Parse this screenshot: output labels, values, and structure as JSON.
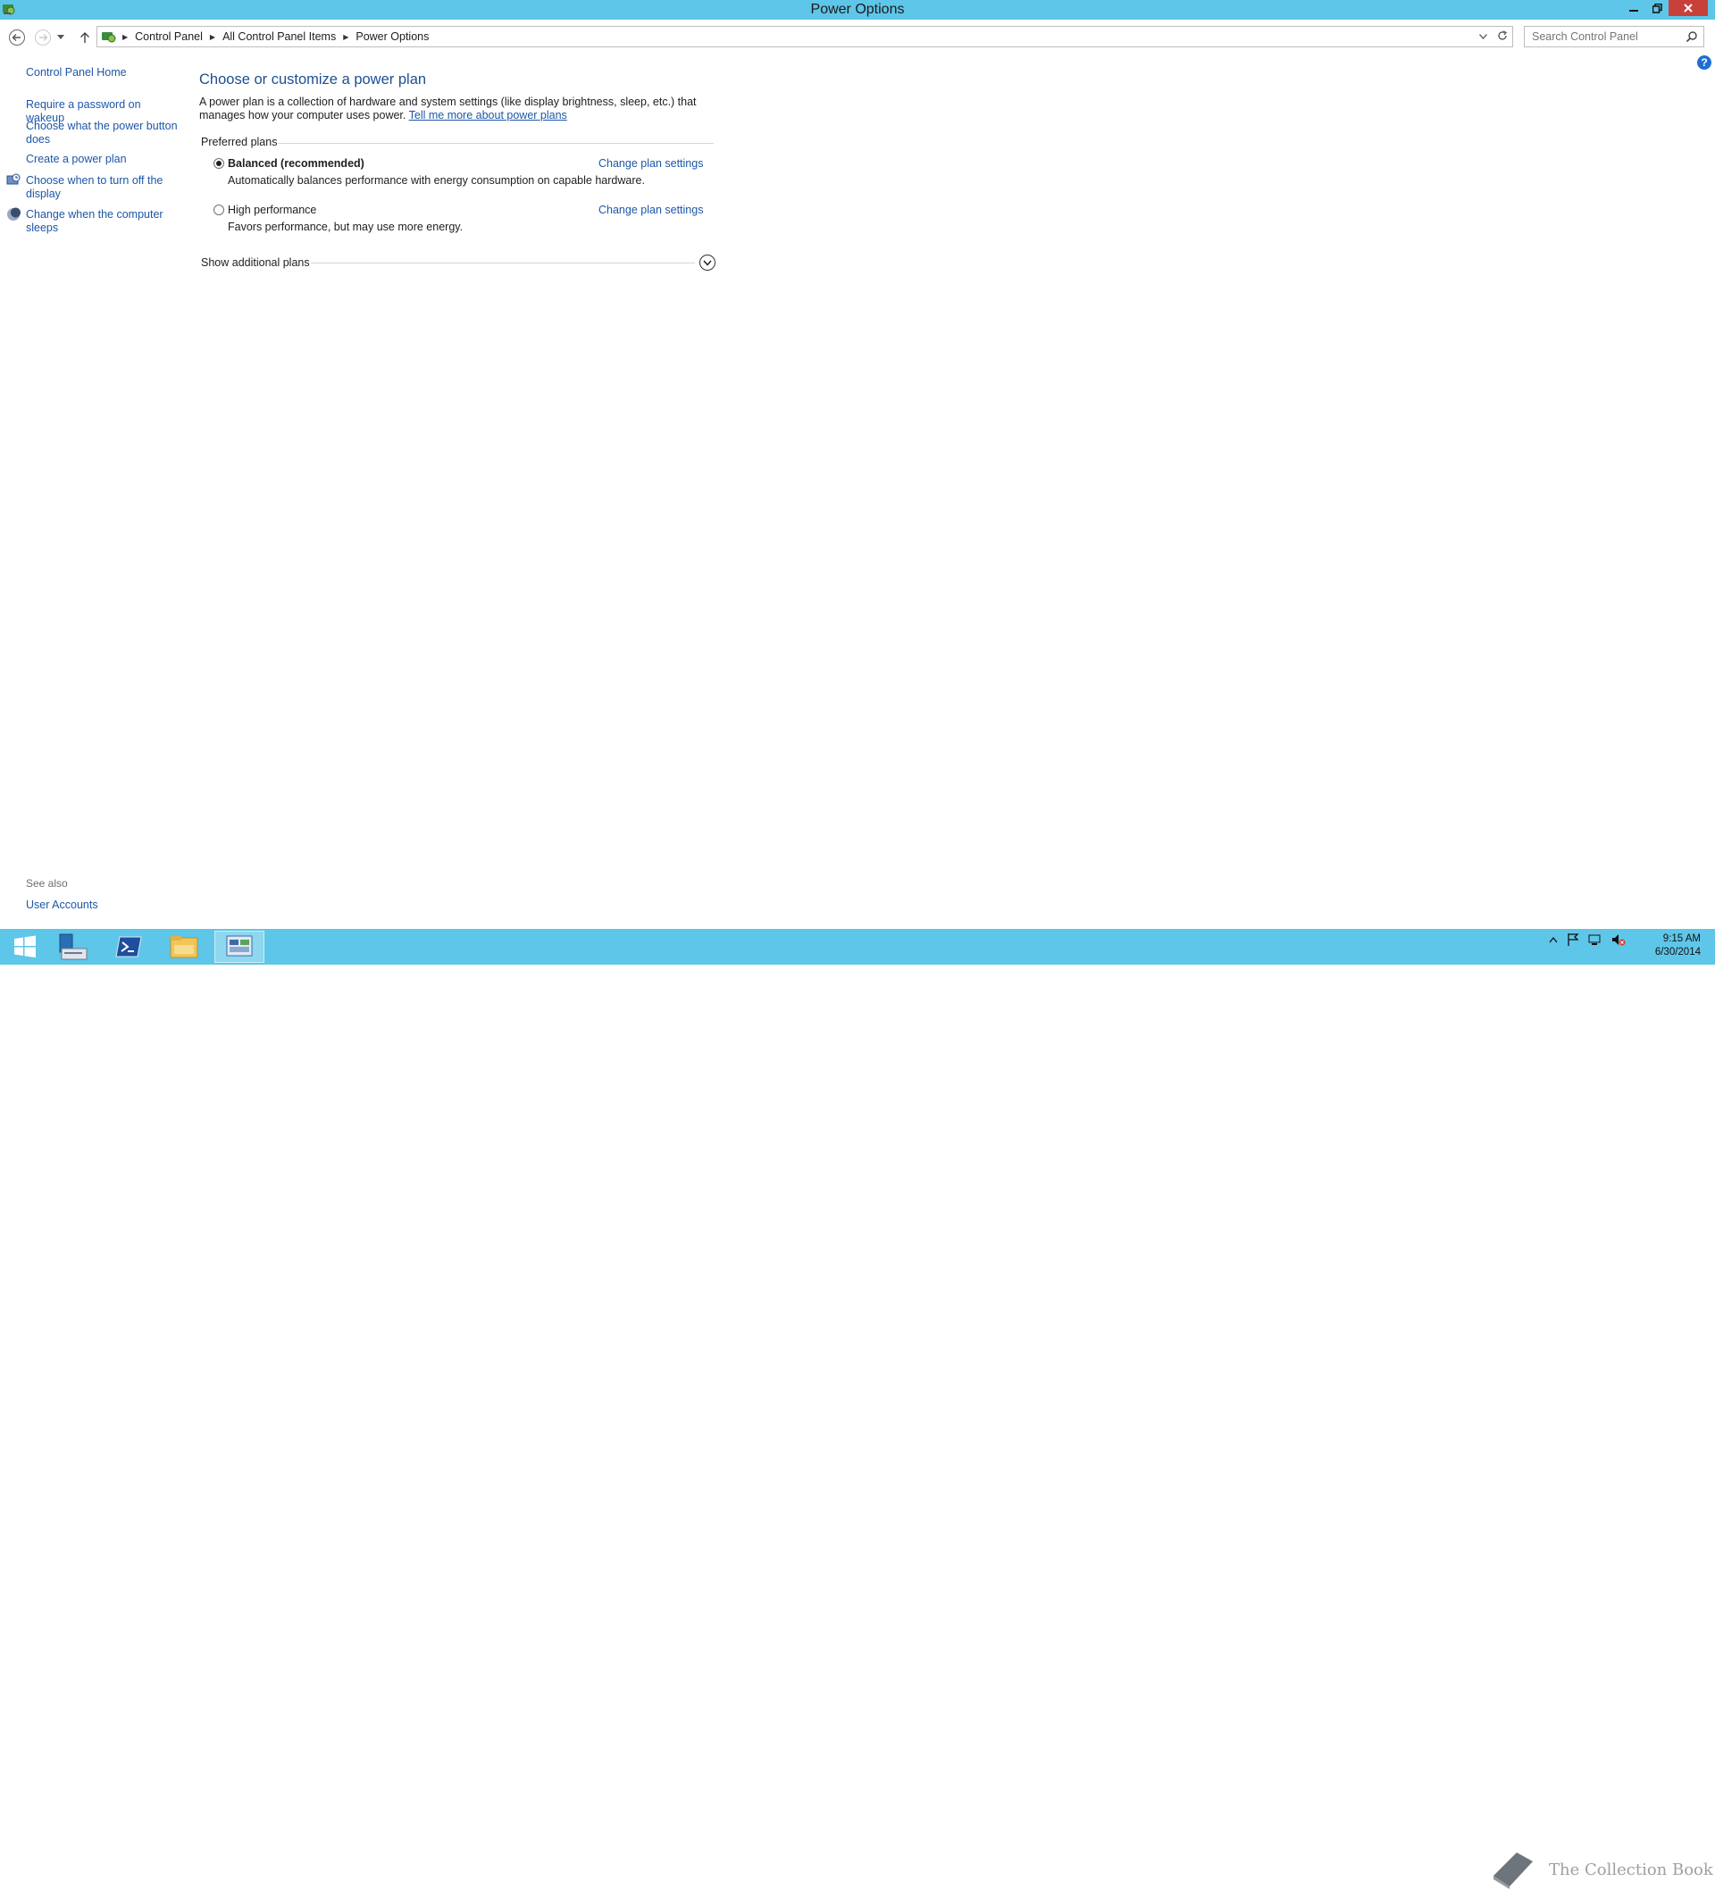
{
  "window": {
    "title": "Power Options"
  },
  "address": {
    "crumbs": [
      "Control Panel",
      "All Control Panel Items",
      "Power Options"
    ],
    "search_placeholder": "Search Control Panel"
  },
  "sidebar": {
    "home": "Control Panel Home",
    "links": [
      "Require a password on wakeup",
      "Choose what the power button does",
      "Create a power plan",
      "Choose when to turn off the display",
      "Change when the computer sleeps"
    ],
    "see_also_label": "See also",
    "see_also_links": [
      "User Accounts"
    ]
  },
  "main": {
    "heading": "Choose or customize a power plan",
    "description": "A power plan is a collection of hardware and system settings (like display brightness, sleep, etc.) that manages how your computer uses power.",
    "learn_more": "Tell me more about power plans",
    "preferred_label": "Preferred plans",
    "plans": [
      {
        "name": "Balanced (recommended)",
        "description": "Automatically balances performance with energy consumption on capable hardware.",
        "link": "Change plan settings",
        "selected": true
      },
      {
        "name": "High performance",
        "description": "Favors performance, but may use more energy.",
        "link": "Change plan settings",
        "selected": false
      }
    ],
    "show_additional": "Show additional plans"
  },
  "taskbar": {
    "watermark": "The Collection Book",
    "time": "9:15 AM",
    "date": "6/30/2014"
  },
  "colors": {
    "chrome": "#5ec6e8",
    "link": "#1c57a8",
    "heading": "#1c4f91",
    "close": "#c7413a"
  }
}
